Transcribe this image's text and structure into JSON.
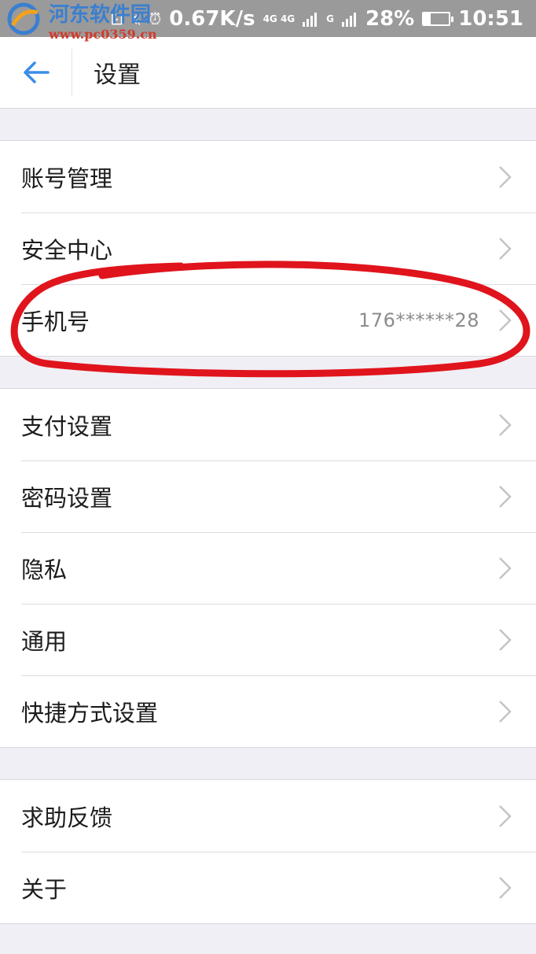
{
  "status_bar": {
    "watermark_title": "河东软件园",
    "watermark_url": "www.pc0359.cn",
    "speed": "0.67K/s",
    "network_4g": "4G 4G",
    "network_g": "G",
    "battery": "28%",
    "battery_level": 0.28,
    "time": "10:51"
  },
  "header": {
    "title": "设置"
  },
  "groups": [
    {
      "items": [
        {
          "label": "账号管理"
        },
        {
          "label": "安全中心"
        },
        {
          "label": "手机号",
          "value": "176******28"
        }
      ]
    },
    {
      "items": [
        {
          "label": "支付设置"
        },
        {
          "label": "密码设置"
        },
        {
          "label": "隐私"
        },
        {
          "label": "通用"
        },
        {
          "label": "快捷方式设置"
        }
      ]
    },
    {
      "items": [
        {
          "label": "求助反馈"
        },
        {
          "label": "关于"
        }
      ]
    }
  ],
  "colors": {
    "accent": "#3a8ee6",
    "annotation": "#e0141c"
  }
}
